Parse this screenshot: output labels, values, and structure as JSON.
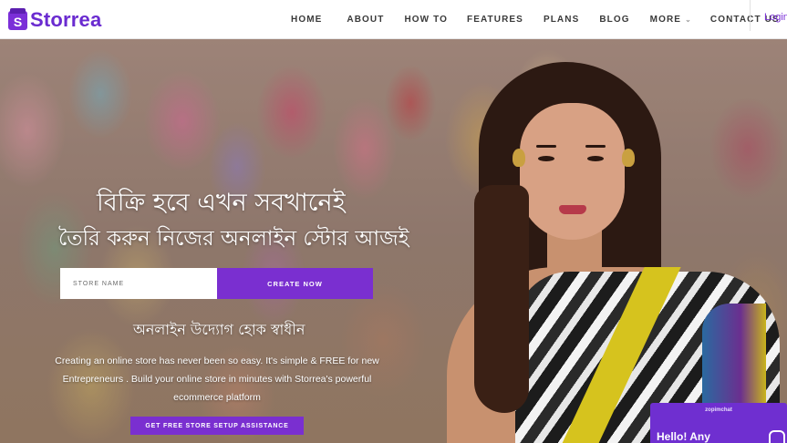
{
  "brand": {
    "logo_letter": "S",
    "name": "Storrea",
    "accent_color": "#7a2fd0"
  },
  "nav": {
    "items": [
      {
        "label": "HOME"
      },
      {
        "label": "ABOUT"
      },
      {
        "label": "HOW TO"
      },
      {
        "label": "FEATURES"
      },
      {
        "label": "PLANS"
      },
      {
        "label": "BLOG"
      },
      {
        "label": "MORE"
      },
      {
        "label": "CONTACT US"
      }
    ],
    "more_icon": "chevron-down-icon",
    "login_label": "Login"
  },
  "hero": {
    "headline": "বিক্রি হবে এখন সবখানেই",
    "subheadline": "তৈরি করুন নিজের অনলাইন স্টোর আজই",
    "store_input_placeholder": "STORE NAME",
    "store_input_value": "",
    "create_button_label": "CREATE NOW",
    "tagline": "অনলাইন উদ্যোগ হোক স্বাধীন",
    "description": "Creating an online store has never been so easy. It's simple & FREE for new Entrepreneurs . Build your online store in minutes with Storrea's powerful ecommerce platform",
    "assist_button_label": "GET FREE STORE SETUP ASSISTANCE"
  },
  "chat_widget": {
    "brand": "zopimchat",
    "greeting": "Hello! Any",
    "icon": "chat-bubble-icon"
  }
}
